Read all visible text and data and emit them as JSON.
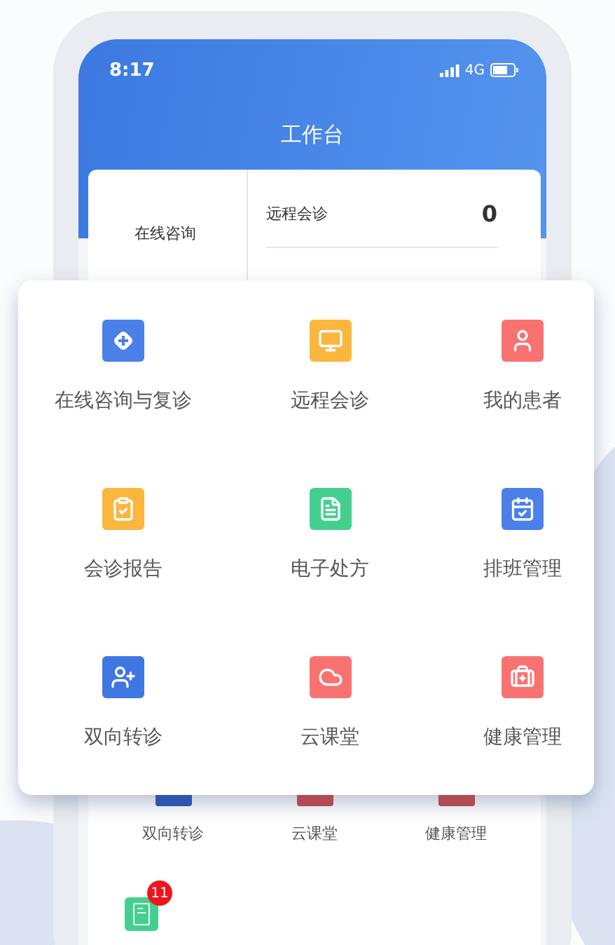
{
  "status_bar": {
    "time": "8:17",
    "network": "4G"
  },
  "header": {
    "title": "工作台"
  },
  "summary": {
    "left_label": "在线咨询",
    "right_label": "远程会诊",
    "right_count": "0"
  },
  "menu_panel": {
    "items": [
      {
        "label": "在线咨询与复诊",
        "color": "#4a80e8"
      },
      {
        "label": "远程会诊",
        "color": "#fbb63e"
      },
      {
        "label": "我的患者",
        "color": "#f97272"
      },
      {
        "label": "会诊报告",
        "color": "#fbb63e"
      },
      {
        "label": "电子处方",
        "color": "#43d08f"
      },
      {
        "label": "排班管理",
        "color": "#4a80e8"
      },
      {
        "label": "双向转诊",
        "color": "#3f77e2"
      },
      {
        "label": "云课堂",
        "color": "#f97272"
      },
      {
        "label": "健康管理",
        "color": "#f97272"
      }
    ]
  },
  "grid_behind": {
    "items": [
      {
        "label": "双向转诊",
        "color": "#2e55b0"
      },
      {
        "label": "云课堂",
        "color": "#b04a55"
      },
      {
        "label": "健康管理",
        "color": "#b04a55"
      }
    ],
    "next_item": {
      "color": "#43d08f",
      "badge": "11"
    }
  }
}
